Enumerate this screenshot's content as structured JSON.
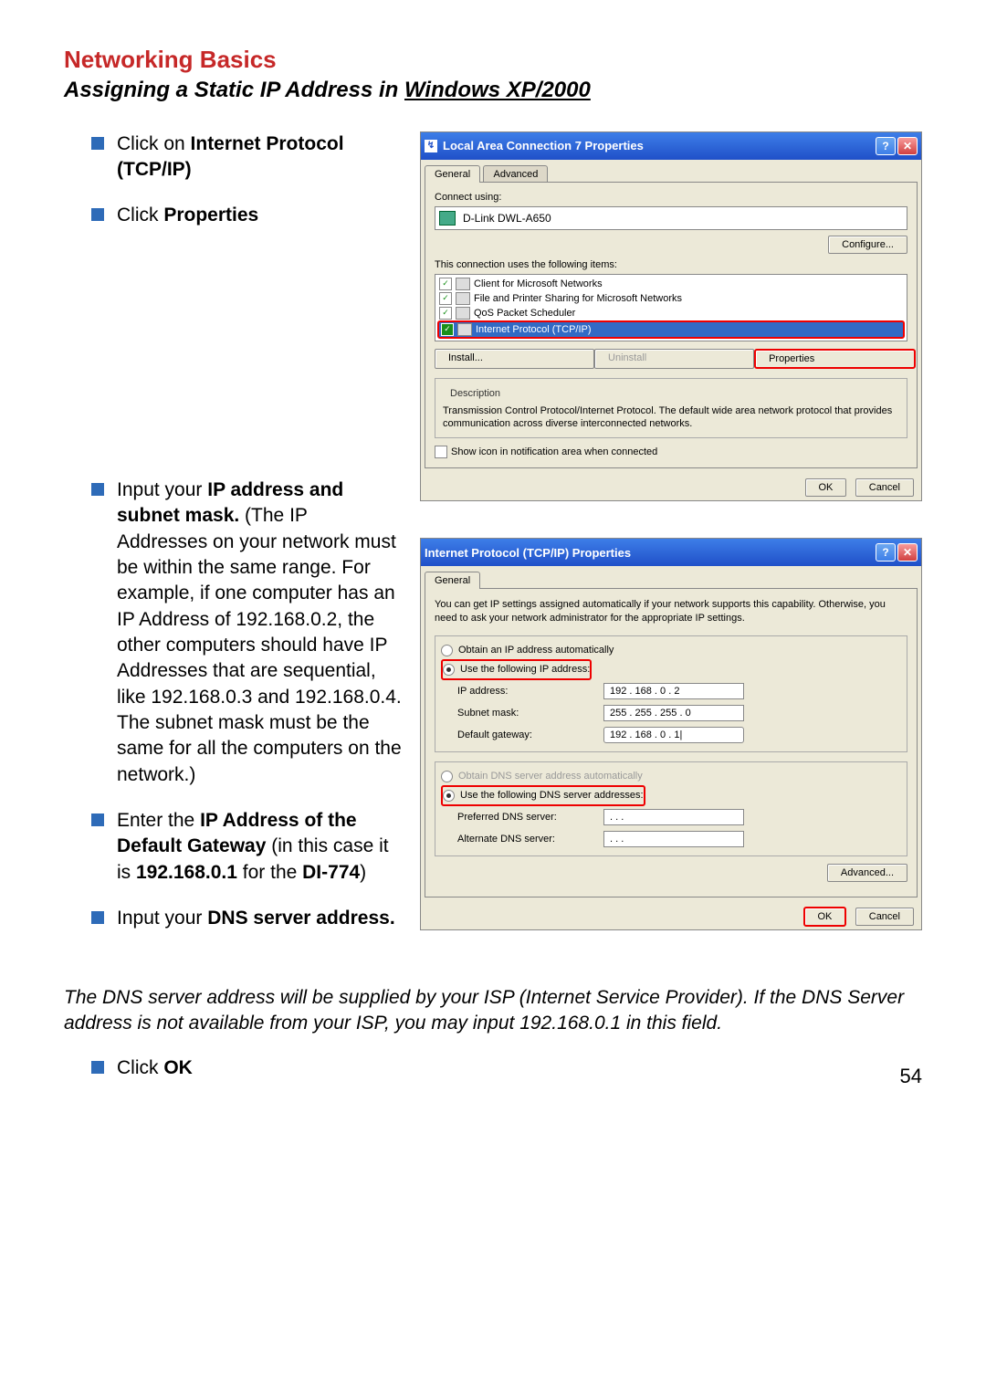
{
  "title": "Networking Basics",
  "subtitle_a": "Assigning a Static IP Address in ",
  "subtitle_b": "Windows XP/2000",
  "bullets": {
    "b1a": "Click on ",
    "b1b": "Internet Protocol (TCP/IP)",
    "b2a": "Click ",
    "b2b": "Properties",
    "b3a": "Input your ",
    "b3b": "IP address and subnet mask.",
    "b3c": " (The IP Addresses on your network must be within the same range. For example, if one computer has an IP Address of 192.168.0.2, the other computers should have IP Addresses that are sequential, like 192.168.0.3 and 192.168.0.4.  The subnet mask must be the same for all the computers on the network.)",
    "b4a": "Enter the ",
    "b4b": "IP Address of the Default Gateway",
    "b4c": " (in this case it is ",
    "b4d": "192.168.0.1",
    "b4e": " for the ",
    "b4f": "DI-774",
    "b4g": ")",
    "b5a": "Input your ",
    "b5b": "DNS server address.",
    "b6a": "Click ",
    "b6b": "OK"
  },
  "footer": "The DNS server address will be supplied by your ISP (Internet Service Provider). If the DNS Server address is not available from your ISP, you may input 192.168.0.1 in this field.",
  "pagenum": "54",
  "dialog1": {
    "title": "Local Area Connection 7 Properties",
    "tab_general": "General",
    "tab_advanced": "Advanced",
    "connect_using": "Connect using:",
    "adapter": "D-Link DWL-A650",
    "configure": "Configure...",
    "uses_items": "This connection uses the following items:",
    "item1": "Client for Microsoft Networks",
    "item2": "File and Printer Sharing for Microsoft Networks",
    "item3": "QoS Packet Scheduler",
    "item4": "Internet Protocol (TCP/IP)",
    "install": "Install...",
    "uninstall": "Uninstall",
    "properties": "Properties",
    "desc_label": "Description",
    "desc_text": "Transmission Control Protocol/Internet Protocol. The default wide area network protocol that provides communication across diverse interconnected networks.",
    "show_icon": "Show icon in notification area when connected",
    "ok": "OK",
    "cancel": "Cancel"
  },
  "dialog2": {
    "title": "Internet Protocol (TCP/IP) Properties",
    "tab_general": "General",
    "intro": "You can get IP settings assigned automatically if your network supports this capability. Otherwise, you need to ask your network administrator for the appropriate IP settings.",
    "r1": "Obtain an IP address automatically",
    "r2": "Use the following IP address:",
    "ip_label": "IP address:",
    "ip_val": "192 . 168 .  0  .  2",
    "sm_label": "Subnet mask:",
    "sm_val": "255 . 255 . 255 .  0",
    "gw_label": "Default gateway:",
    "gw_val": "192 . 168 .  0  .  1|",
    "r3": "Obtain DNS server address automatically",
    "r4": "Use the following DNS server addresses:",
    "pdns_label": "Preferred DNS server:",
    "pdns_val": " .   .   . ",
    "adns_label": "Alternate DNS server:",
    "adns_val": " .   .   . ",
    "advanced": "Advanced...",
    "ok": "OK",
    "cancel": "Cancel"
  }
}
